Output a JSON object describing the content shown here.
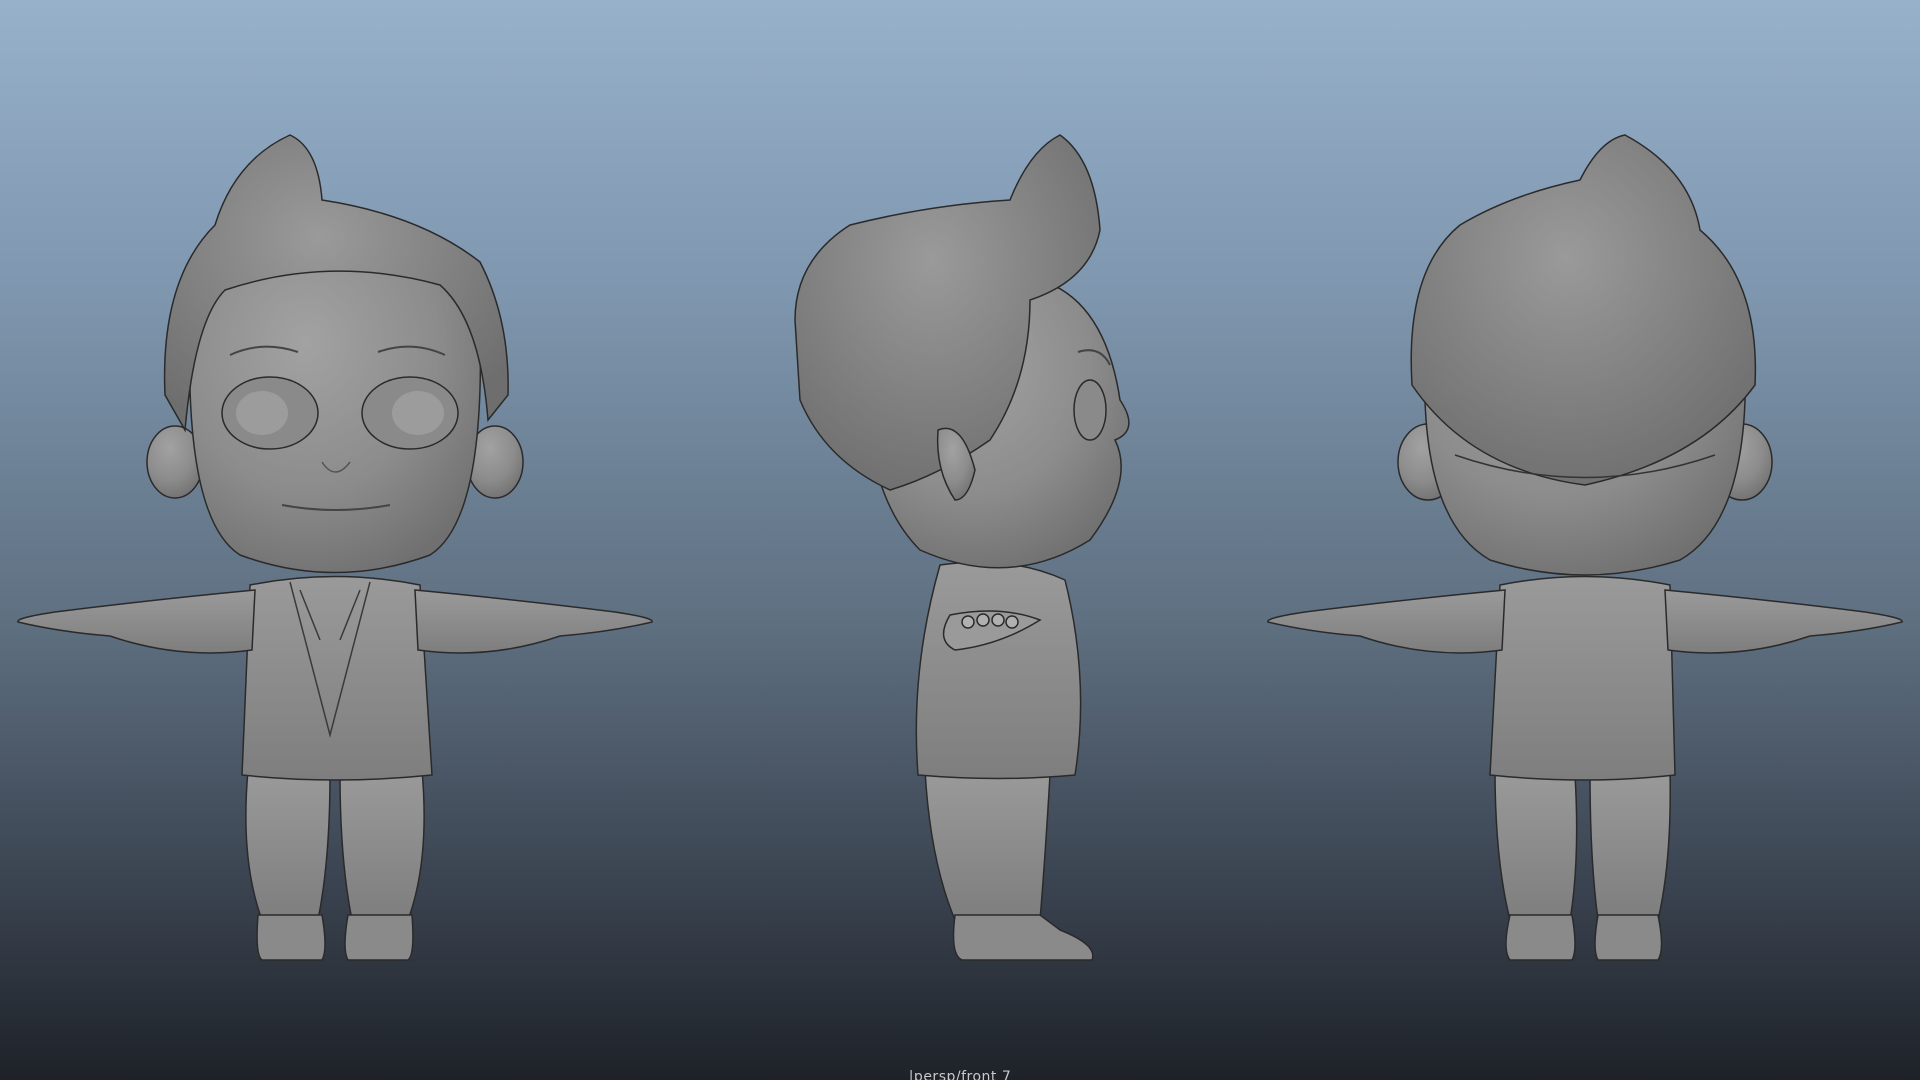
{
  "viewport": {
    "camera_label": "|persp/front 7",
    "views": [
      "front-view",
      "side-view",
      "back-view"
    ],
    "colors": {
      "background_top": "#98b1cb",
      "background_bottom": "#1e2228",
      "model_fill": "#8e8e8e",
      "model_outline": "#222222"
    }
  }
}
